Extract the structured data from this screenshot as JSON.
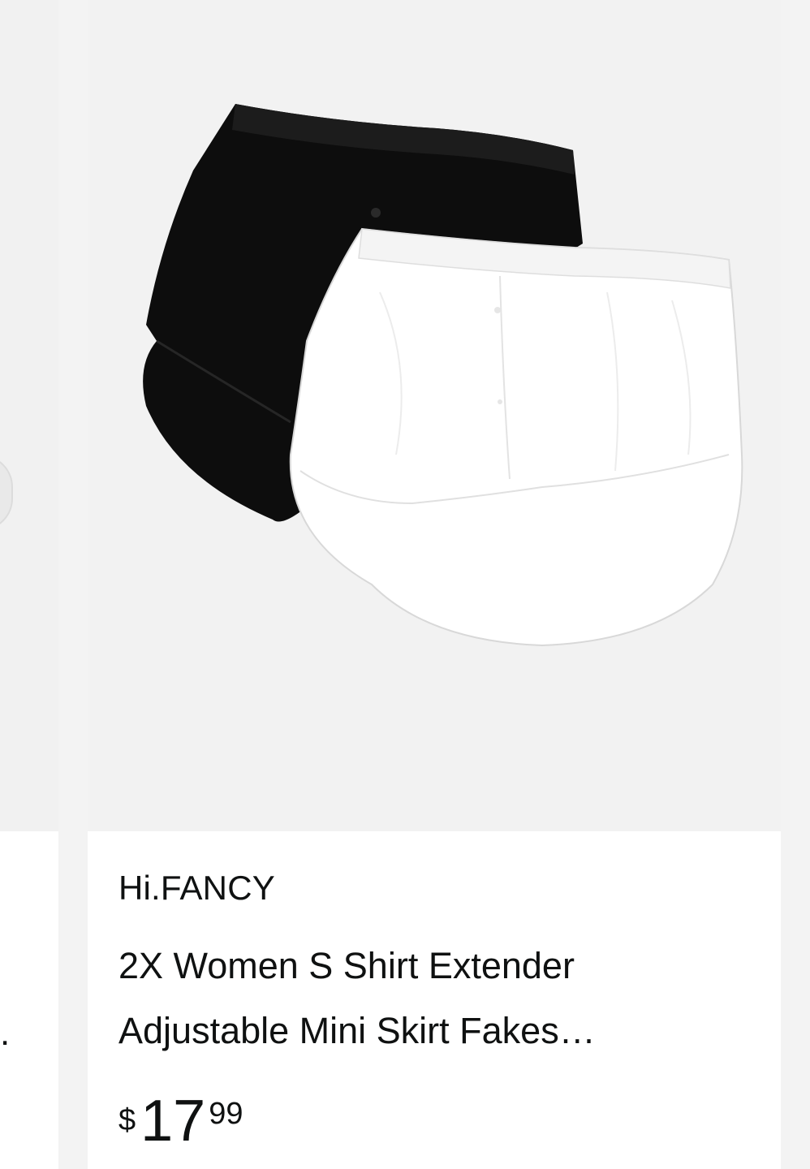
{
  "product": {
    "brand": "Hi.FANCY",
    "title_line1": "2X Women S Shirt Extender",
    "title_line2": "Adjustable Mini Skirt Fakes…",
    "price_symbol": "$",
    "price_whole": "17",
    "price_fraction": "99",
    "image_icon": "shirt-extender-product-image"
  },
  "left_card": {
    "title_ellipsis": "."
  },
  "colors": {
    "text": "#0f1111",
    "card_bg": "#ffffff",
    "image_bg": "#f2f2f2",
    "page_bg": "#f3f3f3"
  }
}
